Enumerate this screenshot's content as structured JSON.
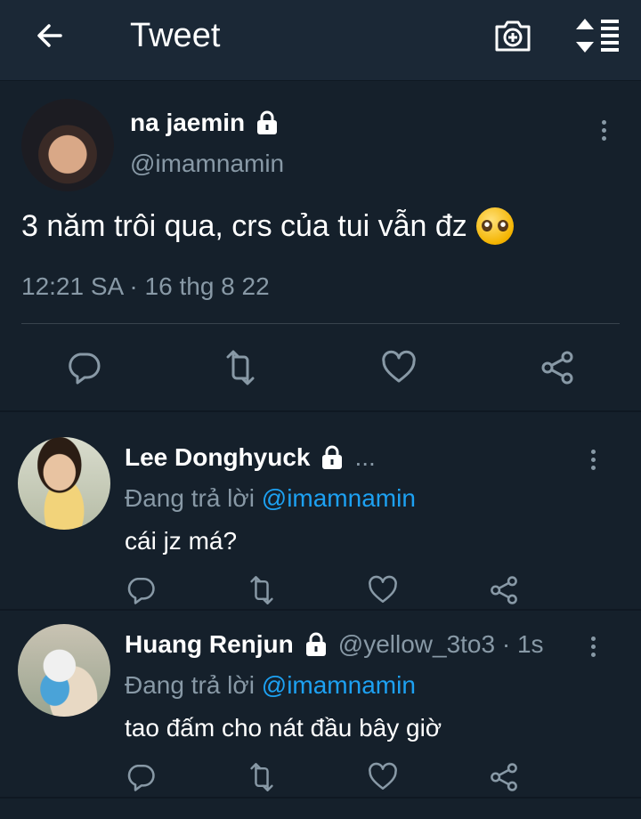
{
  "header": {
    "title": "Tweet",
    "back_icon": "arrow-left-icon",
    "camera_icon": "camera-plus-icon",
    "sort_icon": "sort-icon"
  },
  "main_tweet": {
    "name": "na jaemin",
    "handle": "@imamnamin",
    "text": "3 năm trôi qua, crs của tui vẫn đz",
    "emoji": "pleading-face",
    "timestamp": "12:21 SA · 16 thg 8 22",
    "protected_icon": "lock-icon"
  },
  "replies": [
    {
      "name": "Lee Donghyuck",
      "meta": "...",
      "replying_prefix": "Đang trả lời",
      "replying_to": "@imamnamin",
      "text": "cái jz má?"
    },
    {
      "name": "Huang Renjun",
      "meta": "@yellow_3to3 · 1s",
      "replying_prefix": "Đang trả lời",
      "replying_to": "@imamnamin",
      "text": "tao đấm cho nát đầu bây giờ"
    }
  ],
  "colors": {
    "background": "#15202b",
    "header": "#1b2836",
    "secondary_text": "#8899a6",
    "accent": "#1da1f2",
    "divider": "#38444d"
  }
}
